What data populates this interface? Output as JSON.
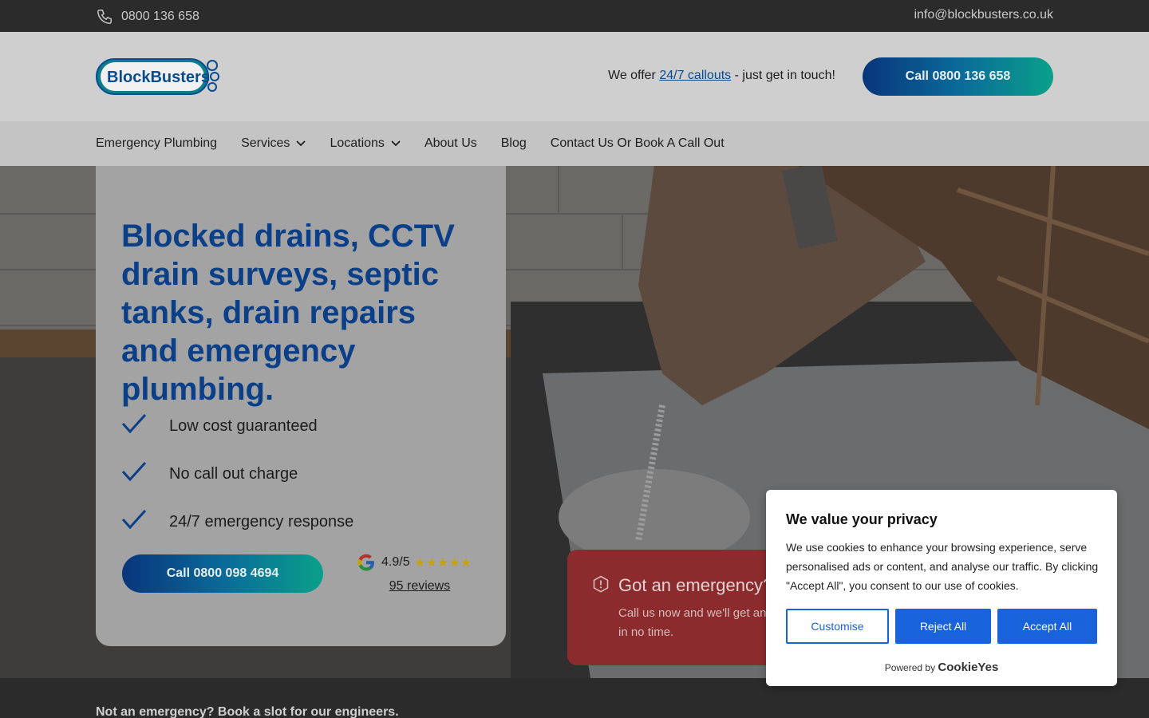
{
  "topbar": {
    "phone": "0800 136 658",
    "email": "info@blockbusters.co.uk"
  },
  "header": {
    "logo_text": "BlockBusters",
    "offer_prefix": "We offer ",
    "offer_link": "24/7 callouts",
    "offer_suffix": " - just get in touch!",
    "call_button": "Call 0800 136 658"
  },
  "nav": {
    "items": [
      {
        "label": "Emergency Plumbing",
        "dropdown": false
      },
      {
        "label": "Services",
        "dropdown": true
      },
      {
        "label": "Locations",
        "dropdown": true
      },
      {
        "label": "About Us",
        "dropdown": false
      },
      {
        "label": "Blog",
        "dropdown": false
      },
      {
        "label": "Contact Us Or Book A Call Out",
        "dropdown": false
      }
    ]
  },
  "hero": {
    "headline": "Blocked drains, CCTV drain surveys, septic tanks, drain repairs and emergency plumbing.",
    "features": [
      "Low cost guaranteed",
      "No call out charge",
      "24/7 emergency response"
    ],
    "call_button": "Call 0800 098 4694",
    "rating": {
      "score": "4.9/5",
      "stars": "★★★★★",
      "reviews": "95 reviews"
    }
  },
  "emergency": {
    "title": "Got an emergency?",
    "body": "Call us now and we'll get an engineer to help you in no time."
  },
  "bottom": {
    "text": "Not an emergency? Book a slot for our engineers."
  },
  "cookie": {
    "title": "We value your privacy",
    "body": "We use cookies to enhance your browsing experience, serve personalised ads or content, and analyse our traffic. By clicking \"Accept All\", you consent to our use of cookies.",
    "customise": "Customise",
    "reject": "Reject All",
    "accept": "Accept All",
    "powered_by": "Powered by",
    "brand": "CookieYes"
  },
  "colors": {
    "brand_blue": "#0b3f87",
    "brand_teal": "#0aa08a",
    "cookie_blue": "#1863dc",
    "emergency_red": "#8c2b2e"
  },
  "icons": [
    "phone-icon",
    "chevron-down-icon",
    "check-icon",
    "google-icon",
    "alert-icon"
  ]
}
